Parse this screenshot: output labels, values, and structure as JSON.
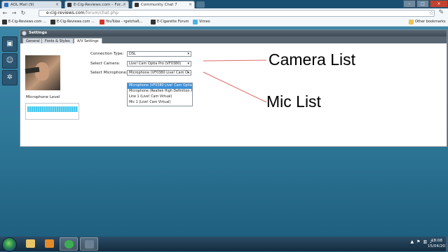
{
  "browser": {
    "tabs": [
      {
        "title": "AOL Mail (9)",
        "favicon_color": "#2a6fbf"
      },
      {
        "title": "E-Cig-Reviews.com – For...",
        "favicon_color": "#333333"
      },
      {
        "title": "Community Chat 7",
        "favicon_color": "#333333"
      }
    ],
    "url_host": "e-cig-reviews.com",
    "url_path": "/forum/chat.php",
    "bookmarks": [
      {
        "label": "E-Cig-Reviews.com ...",
        "icon_color": "#333333"
      },
      {
        "label": "E-Cig-Reviews.com ...",
        "icon_color": "#333333"
      },
      {
        "label": "YouTube - rgetcha6...",
        "icon_color": "#d6332a"
      },
      {
        "label": "E-Cigarette Forum",
        "icon_color": "#333333"
      },
      {
        "label": "Vimeo",
        "icon_color": "#4bb3e6"
      }
    ],
    "other_bookmarks": "Other bookmarks"
  },
  "settings": {
    "title": "Settings",
    "tabs": [
      "General",
      "Fonts & Styles",
      "A/V Settings"
    ],
    "active_tab": "A/V Settings",
    "mic_level_label": "Microphone Level",
    "mic_level": 1.0,
    "connection_type_label": "Connection Type:",
    "connection_type_value": "DSL",
    "select_camera_label": "Select Camera:",
    "select_camera_value": "Live! Cam Optia Pro (VF0380)",
    "select_mic_label": "Select Microphone:",
    "select_mic_value": "Microphone (VF0380 Live! Cam O...",
    "mic_options": [
      "Microphone (VF0380 Live! Cam Optia Pr",
      "Microphone (Realtek High Definition Au",
      "Line 1 (Live! Cam Virtual)",
      "Mic 1 (Live! Cam Virtual)"
    ],
    "selected_mic_option": 0
  },
  "annotations": {
    "camera": "Camera List",
    "mic": "Mic List",
    "line_color": "#e06a6a"
  },
  "taskbar": {
    "time": "18:08",
    "date": "15/04/2011",
    "apps": [
      {
        "name": "explorer",
        "color": "#e7c36a"
      },
      {
        "name": "media-player",
        "color": "#e58a2a"
      },
      {
        "name": "chrome",
        "color": "#3cae51"
      },
      {
        "name": "webcam",
        "color": "#6d8196"
      }
    ]
  }
}
